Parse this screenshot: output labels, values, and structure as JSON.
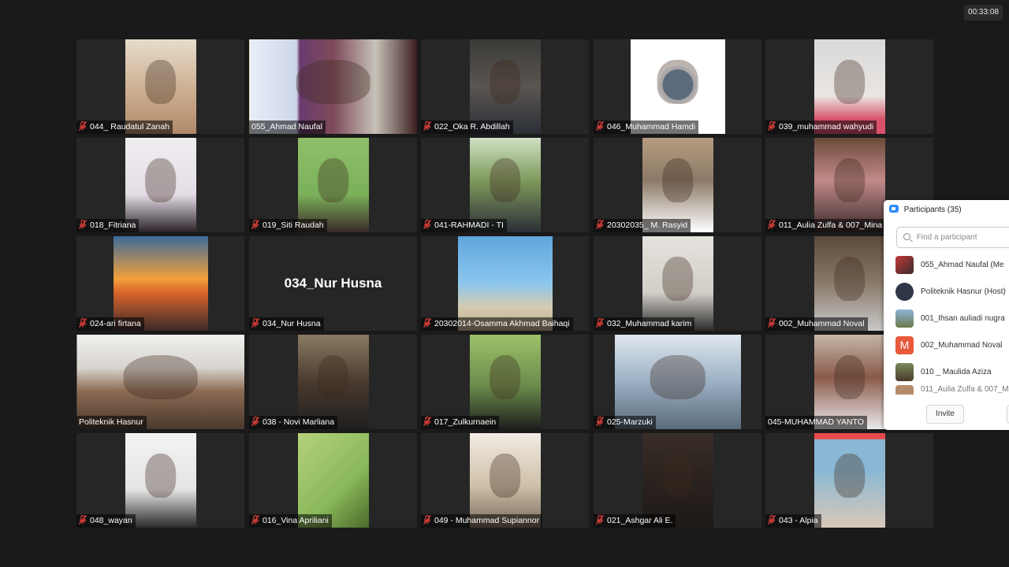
{
  "meeting": {
    "elapsed_time": "00:33:08"
  },
  "tiles": [
    {
      "name": "044_ Raudatul Zanah",
      "muted": true
    },
    {
      "name": "055_Ahmad Naufal",
      "muted": false,
      "active_speaker": true
    },
    {
      "name": "022_Oka R. Abdillah",
      "muted": true
    },
    {
      "name": "046_Muhammad Hamdi",
      "muted": true
    },
    {
      "name": "039_muhammad wahyudi",
      "muted": true
    },
    {
      "name": "018_Fitriana",
      "muted": true
    },
    {
      "name": "019_Siti Raudah",
      "muted": true
    },
    {
      "name": "041-RAHMADI - TI",
      "muted": true
    },
    {
      "name": "20302035_ M. Rasyid",
      "muted": true
    },
    {
      "name": "011_Aulia Zulfa & 007_Mina",
      "muted": true
    },
    {
      "name": "024-ari firtana",
      "muted": true
    },
    {
      "name": "034_Nur Husna",
      "muted": true,
      "video_off": true,
      "big_label": "034_Nur Husna"
    },
    {
      "name": "20302014-Osamma Akhmad Baihaqi",
      "muted": true
    },
    {
      "name": "032_Muhammad karim",
      "muted": true
    },
    {
      "name": "002_Muhammad Noval",
      "muted": true
    },
    {
      "name": "Politeknik Hasnur",
      "muted": false
    },
    {
      "name": "038 - Novi Marliana",
      "muted": true
    },
    {
      "name": "017_Zulkurnaein",
      "muted": true
    },
    {
      "name": "025-Marzuki",
      "muted": true
    },
    {
      "name": "045-MUHAMMAD YANTO",
      "muted": false
    },
    {
      "name": "048_wayan",
      "muted": true
    },
    {
      "name": "016_Vina Apriliani",
      "muted": true
    },
    {
      "name": "049 - Muhammad Supiannor",
      "muted": true
    },
    {
      "name": "021_Ashgar Ali E.",
      "muted": true
    },
    {
      "name": "043 - Alpia",
      "muted": true
    }
  ],
  "participants_panel": {
    "title": "Participants (35)",
    "search_placeholder": "Find a participant",
    "items": [
      {
        "name": "055_Ahmad Naufal (Me"
      },
      {
        "name": "Politeknik Hasnur (Host)"
      },
      {
        "name": "001_Ihsan auliadi nugra"
      },
      {
        "name": "002_Muhammad Noval",
        "avatar_letter": "M"
      },
      {
        "name": "010 _ Maulida Aziza"
      },
      {
        "name": "011_Aulia Zulfa & 007_M"
      }
    ],
    "invite_label": "Invite"
  },
  "colors": {
    "active_speaker_border": "#e5e16a",
    "muted_icon": "#e0403a",
    "background": "#1a1a1a"
  }
}
